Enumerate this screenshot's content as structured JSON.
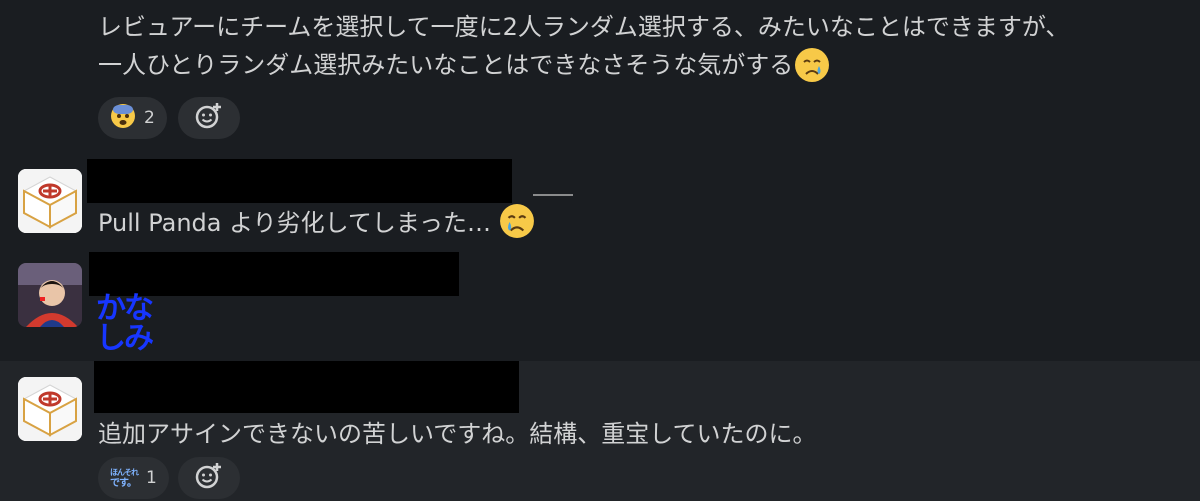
{
  "messages": [
    {
      "text_line1": "レビュアーにチームを選択して一度に2人ランダム選択する、みたいなことはできますが、",
      "text_line2": "一人ひとりランダム選択みたいなことはできなさそうな気がする",
      "reactions": [
        {
          "emoji": "fearful-face",
          "count": "2"
        }
      ]
    },
    {
      "text": "Pull Panda より劣化してしまった…"
    },
    {
      "sticker_text_line1": "かな",
      "sticker_text_line2": "しみ"
    },
    {
      "text": "追加アサインできないの苦しいですね。結構、重宝していたのに。",
      "reactions": [
        {
          "emoji": "honsore-desu",
          "label_top": "ほんそれ",
          "label_bottom": "です。",
          "count": "1"
        }
      ]
    }
  ],
  "colors": {
    "background": "#1a1d21",
    "hover_background": "#222529",
    "text": "#d1d2d3",
    "reaction_bg": "#2c2f33",
    "sticker_blue": "#1736ff"
  }
}
